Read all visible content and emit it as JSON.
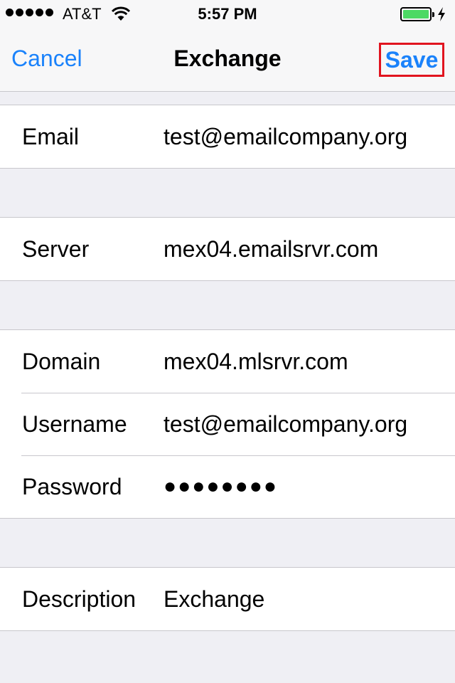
{
  "status_bar": {
    "carrier": "AT&T",
    "time": "5:57 PM",
    "signal_bars": 5,
    "battery_level": 1.0,
    "battery_color": "#4cd964",
    "charging": true
  },
  "nav": {
    "cancel_label": "Cancel",
    "title": "Exchange",
    "save_label": "Save",
    "accent_color": "#1a82fb",
    "highlight_color": "#e1141f"
  },
  "account": {
    "email": {
      "label": "Email",
      "value": "test@emailcompany.org"
    },
    "server": {
      "label": "Server",
      "value": "mex04.emailsrvr.com"
    },
    "domain": {
      "label": "Domain",
      "value": "mex04.mlsrvr.com"
    },
    "username": {
      "label": "Username",
      "value": "test@emailcompany.org"
    },
    "password": {
      "label": "Password",
      "value": "●●●●●●●●"
    },
    "description": {
      "label": "Description",
      "value": "Exchange"
    }
  }
}
